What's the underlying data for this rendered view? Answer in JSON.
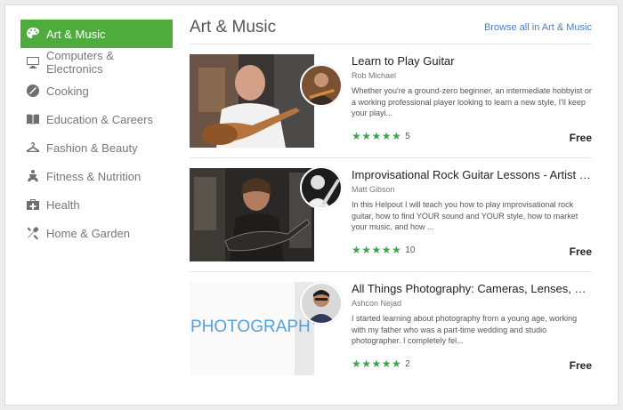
{
  "sidebar": {
    "items": [
      {
        "label": "Art & Music",
        "icon": "palette-icon",
        "active": true
      },
      {
        "label": "Computers & Electronics",
        "icon": "monitor-icon"
      },
      {
        "label": "Cooking",
        "icon": "cooking-icon"
      },
      {
        "label": "Education & Careers",
        "icon": "book-icon"
      },
      {
        "label": "Fashion & Beauty",
        "icon": "hanger-icon"
      },
      {
        "label": "Fitness & Nutrition",
        "icon": "fitness-icon"
      },
      {
        "label": "Health",
        "icon": "first-aid-icon"
      },
      {
        "label": "Home & Garden",
        "icon": "tools-icon"
      }
    ]
  },
  "main": {
    "title": "Art & Music",
    "browse_link": "Browse all in Art & Music",
    "listings": [
      {
        "title": "Learn to Play Guitar",
        "author": "Rob Michael",
        "description": "Whether you're a ground-zero beginner, an intermediate hobbyist or a working professional player looking to learn a new style, I'll keep your playi...",
        "stars": "★★★★★",
        "rating_count": "5",
        "price": "Free"
      },
      {
        "title": "Improvisational Rock Guitar Lessons - Artist De...",
        "author": "Matt Gibson",
        "description": "In this Helpout I will teach you how to play improvisational rock guitar, how to find YOUR sound and YOUR style, how to market your music, and how ...",
        "stars": "★★★★★",
        "rating_count": "10",
        "price": "Free"
      },
      {
        "title": "All Things Photography: Cameras, Lenses, Equip...",
        "author": "Ashcon Nejad",
        "description": "I started learning about photography from a young age, working with my father who was a part-time wedding and studio photographer. I completely fel...",
        "stars": "★★★★★",
        "rating_count": "2",
        "price": "Free",
        "thumb_text": "PHOTOGRAPHY"
      }
    ]
  },
  "colors": {
    "accent": "#4eac3d",
    "link": "#4a7fc1",
    "stars": "#3fa34d"
  }
}
